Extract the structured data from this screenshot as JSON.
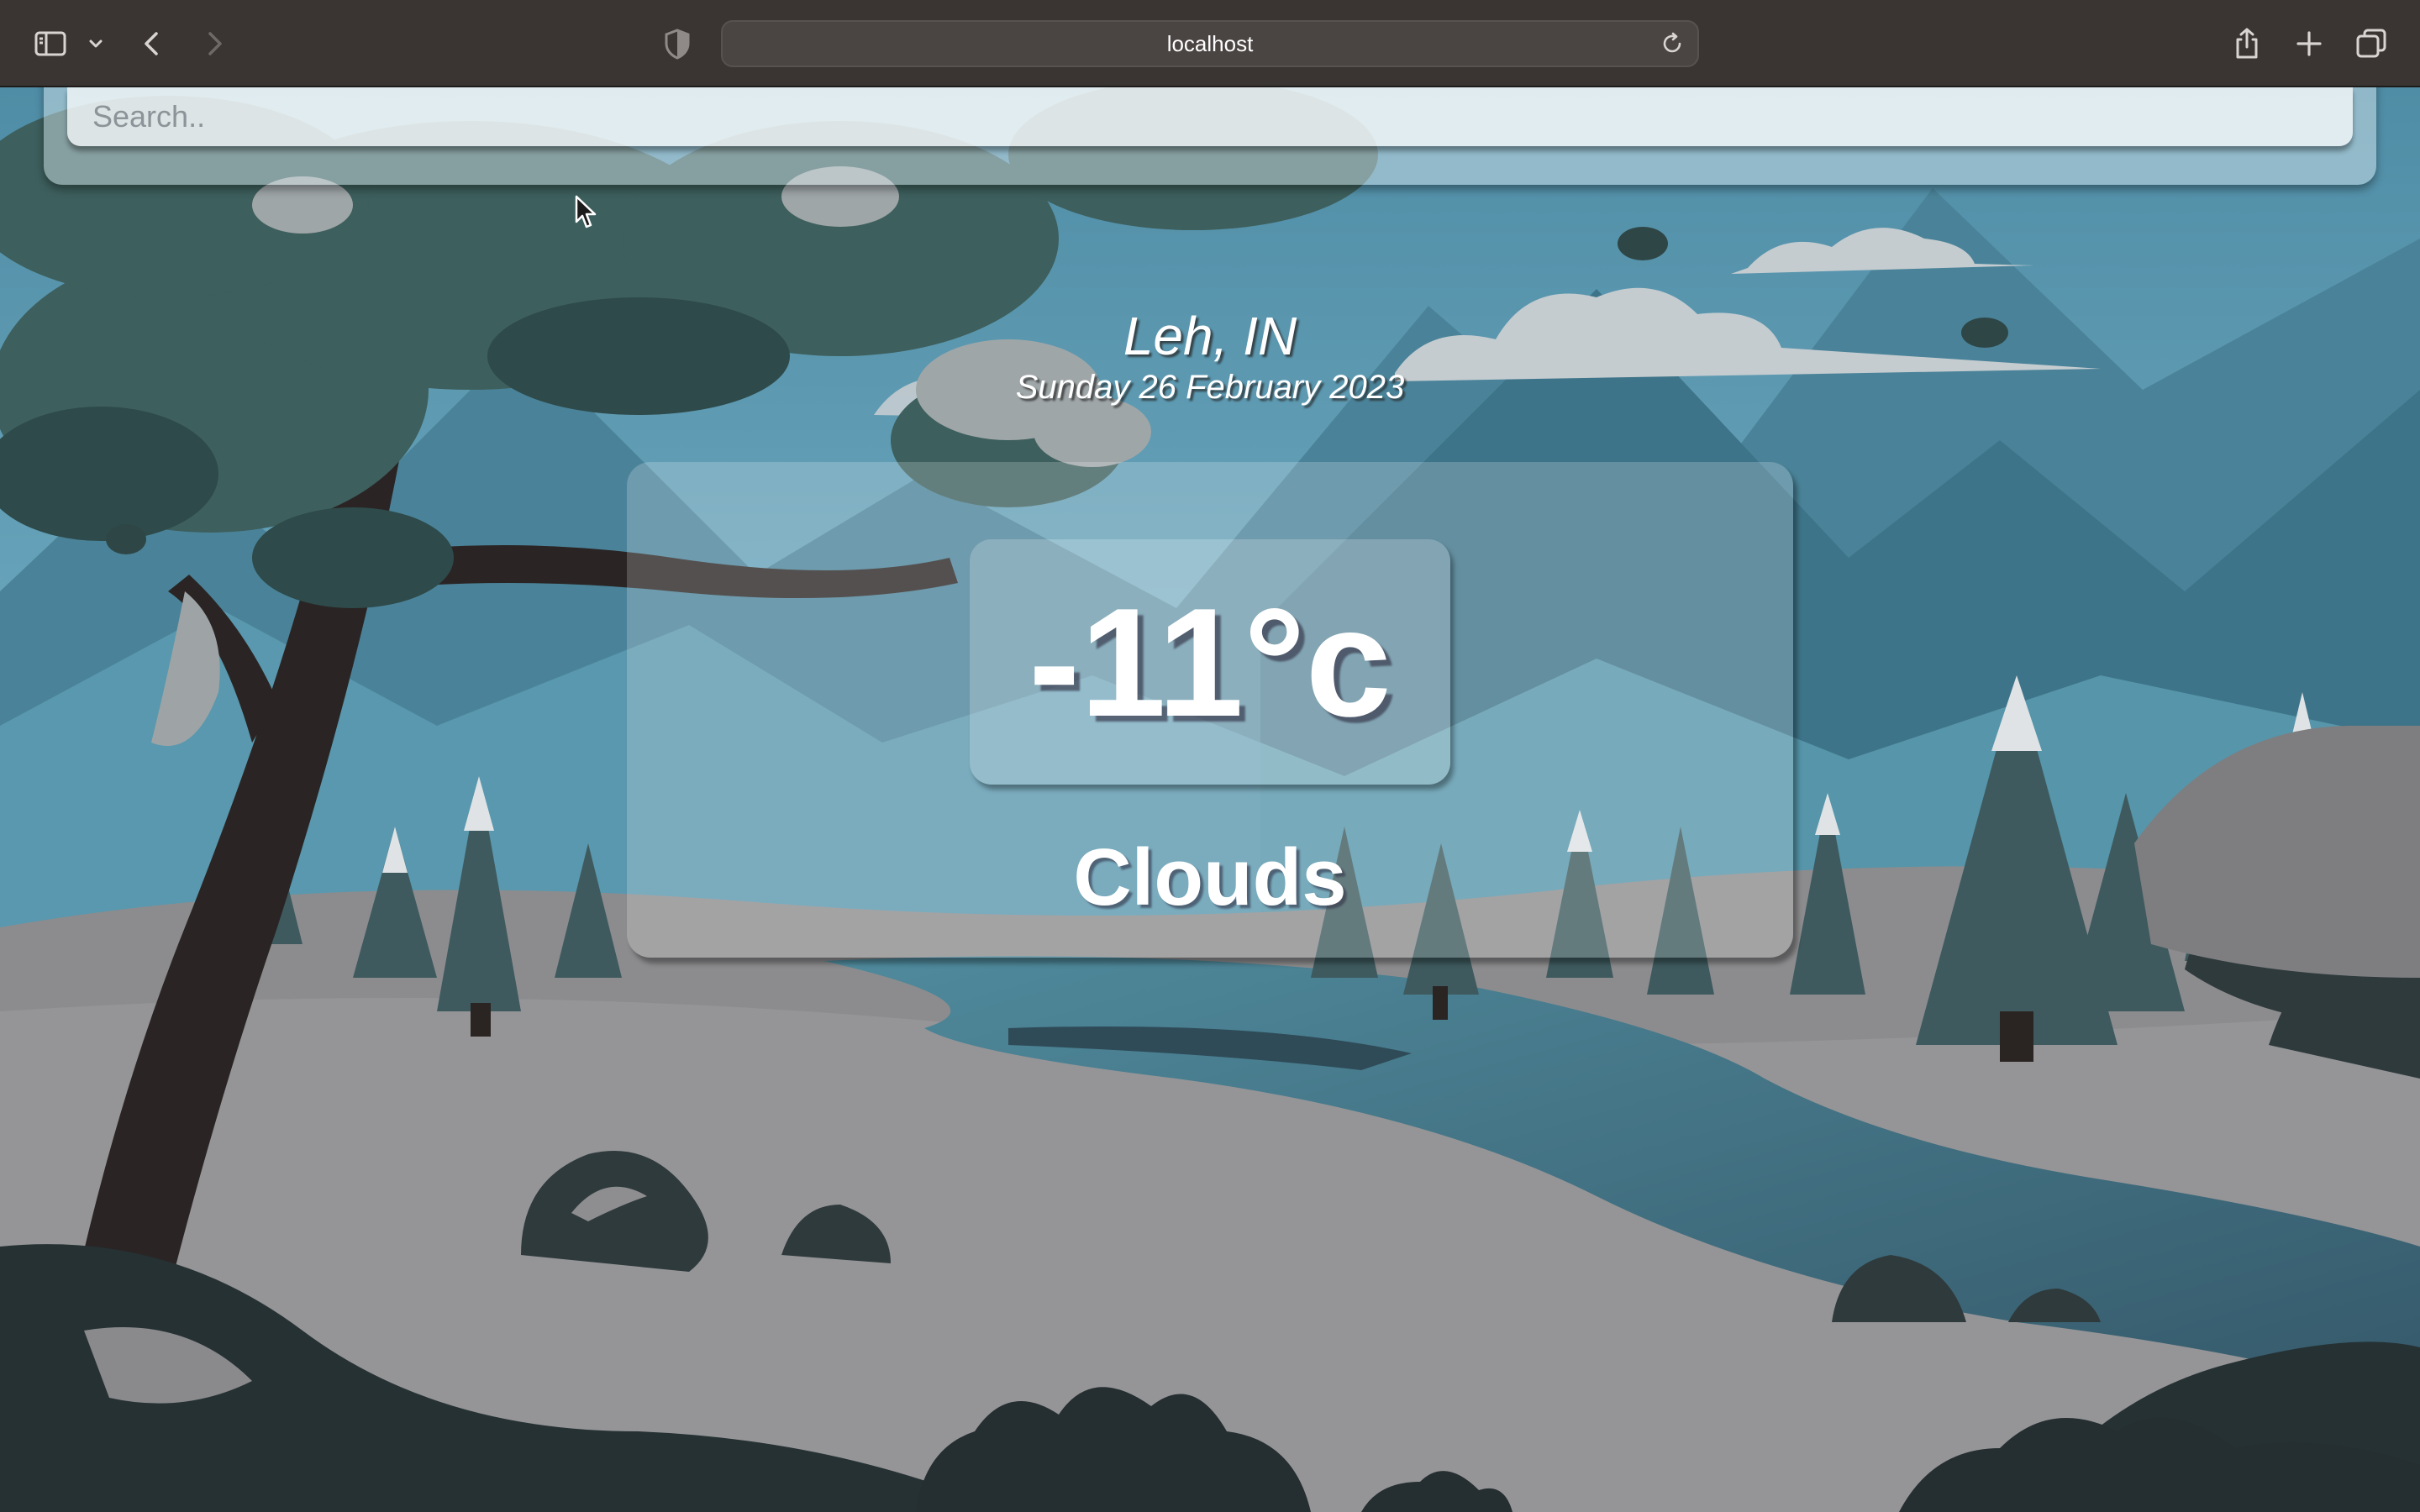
{
  "browser": {
    "address": "localhost"
  },
  "search": {
    "placeholder": "Search..",
    "value": ""
  },
  "location": {
    "city": "Leh, IN",
    "date": "Sunday 26 February 2023"
  },
  "weather": {
    "temperature": "-11°c",
    "condition": "Clouds"
  },
  "icons": {
    "sidebar": "sidebar-icon",
    "sidebar_menu": "chevron-down-icon",
    "back": "chevron-left-icon",
    "forward": "chevron-right-icon",
    "privacy": "shield-icon",
    "reload": "reload-icon",
    "share": "share-icon",
    "new_tab": "plus-icon",
    "tabs": "tabs-overview-icon"
  },
  "colors": {
    "toolbar": "#3a3533",
    "sky": "#5f9fb6",
    "snow": "#8b8b8d",
    "river": "#3f6f80"
  }
}
